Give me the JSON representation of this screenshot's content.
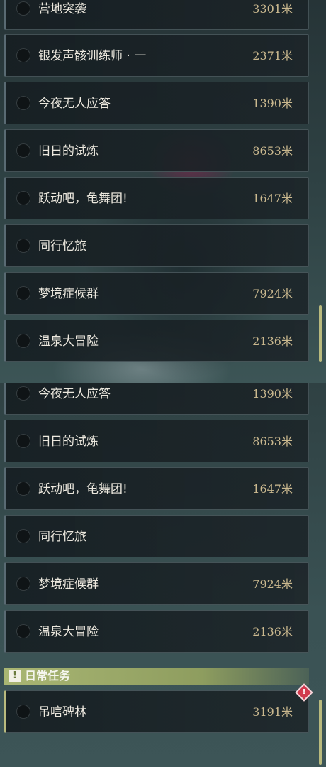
{
  "top_list": [
    {
      "name": "营地突袭",
      "distance": "3301米"
    },
    {
      "name": "银发声骸训练师 · 一",
      "distance": "2371米"
    },
    {
      "name": "今夜无人应答",
      "distance": "1390米"
    },
    {
      "name": "旧日的试炼",
      "distance": "8653米"
    },
    {
      "name": "跃动吧，龟舞团!",
      "distance": "1647米"
    },
    {
      "name": "同行忆旅",
      "distance": ""
    },
    {
      "name": "梦境症候群",
      "distance": "7924米"
    },
    {
      "name": "温泉大冒险",
      "distance": "2136米"
    }
  ],
  "bottom_list": [
    {
      "name": "今夜无人应答",
      "distance": "1390米"
    },
    {
      "name": "旧日的试炼",
      "distance": "8653米"
    },
    {
      "name": "跃动吧，龟舞团!",
      "distance": "1647米"
    },
    {
      "name": "同行忆旅",
      "distance": ""
    },
    {
      "name": "梦境症候群",
      "distance": "7924米"
    },
    {
      "name": "温泉大冒险",
      "distance": "2136米"
    }
  ],
  "daily_section": {
    "badge": "!",
    "title": "日常任务",
    "items": [
      {
        "name": "吊唁碑林",
        "distance": "3191米"
      }
    ]
  },
  "icons": {
    "task_status": "circle-icon",
    "daily_badge": "exclamation-icon",
    "alert": "alert-diamond-icon"
  },
  "colors": {
    "task_name": "#ece8de",
    "task_distance": "#cbb98f",
    "section_header": "#a9b673",
    "alert": "#d13a4d"
  }
}
